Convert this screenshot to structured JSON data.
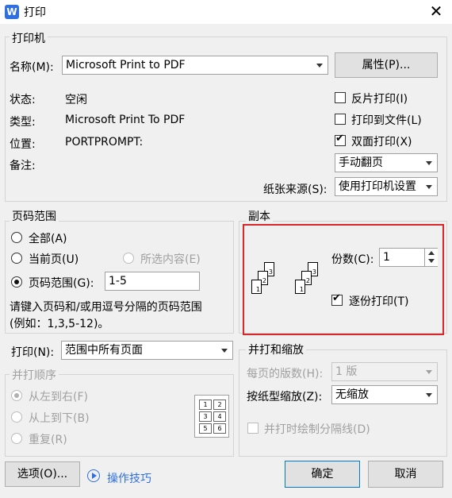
{
  "window": {
    "title": "打印",
    "app_icon_glyph": "W"
  },
  "printer": {
    "group_label": "打印机",
    "name_label": "名称(M):",
    "name_value": "Microsoft Print to PDF",
    "properties_button": "属性(P)...",
    "status_label": "状态:",
    "status_value": "空闲",
    "type_label": "类型:",
    "type_value": "Microsoft Print To PDF",
    "location_label": "位置:",
    "location_value": "PORTPROMPT:",
    "comment_label": "备注:",
    "reverse_print": {
      "label": "反片打印(I)",
      "checked": false
    },
    "print_to_file": {
      "label": "打印到文件(L)",
      "checked": false
    },
    "duplex": {
      "label": "双面打印(X)",
      "checked": true
    },
    "duplex_mode": "手动翻页",
    "paper_source_label": "纸张来源(S):",
    "paper_source_value": "使用打印机设置"
  },
  "page_range": {
    "group_label": "页码范围",
    "all": "全部(A)",
    "current": "当前页(U)",
    "selection": "所选内容(E)",
    "pages": "页码范围(G):",
    "pages_value": "1-5",
    "hint_line1": "请键入页码和/或用逗号分隔的页码范围",
    "hint_line2": "(例如：1,3,5-12)。"
  },
  "copies": {
    "group_label": "副本",
    "count_label": "份数(C):",
    "count_value": "1",
    "collate": {
      "label": "逐份打印(T)",
      "checked": true
    },
    "page_numbers": [
      "1",
      "2",
      "3"
    ],
    "highlight_color": "#d9262b"
  },
  "print_what": {
    "label": "打印(N):",
    "value": "范围中所有页面"
  },
  "order": {
    "group_label": "并打顺序",
    "left_to_right": "从左到右(F)",
    "top_to_bottom": "从上到下(B)",
    "repeat": "重复(R)",
    "grid_numbers": [
      "1",
      "2",
      "3",
      "4",
      "5",
      "6"
    ]
  },
  "zoom": {
    "group_label": "并打和缩放",
    "pages_per_sheet_label": "每页的版数(H):",
    "pages_per_sheet_value": "1 版",
    "scale_label": "按纸型缩放(Z):",
    "scale_value": "无缩放",
    "divider": {
      "label": "并打时绘制分隔线(D)",
      "checked": false
    }
  },
  "footer": {
    "options_button": "选项(O)...",
    "tips_link": "操作技巧",
    "ok_button": "确定",
    "cancel_button": "取消"
  }
}
